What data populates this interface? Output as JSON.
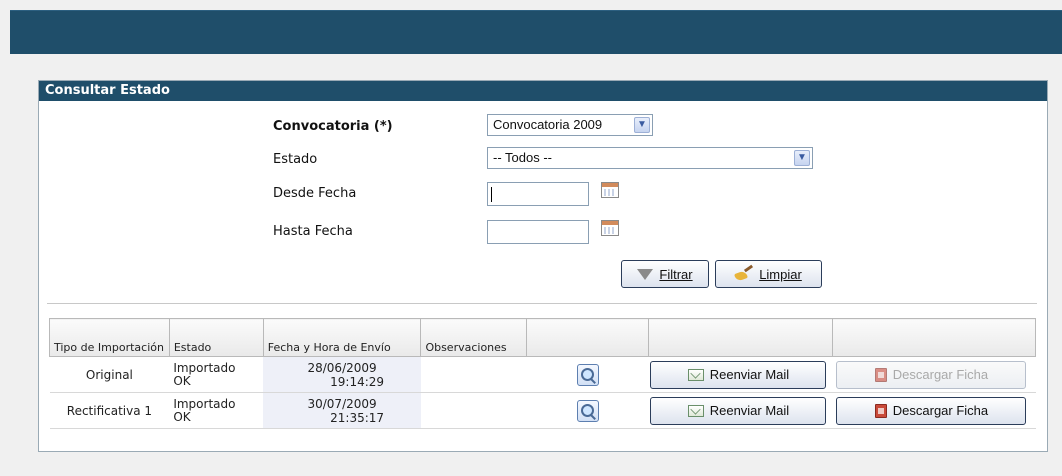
{
  "panel": {
    "title": "Consultar Estado"
  },
  "form": {
    "convocatoria": {
      "label": "Convocatoria (*)",
      "value": "Convocatoria 2009"
    },
    "estado": {
      "label": "Estado",
      "value": "-- Todos --"
    },
    "desde_fecha": {
      "label": "Desde Fecha",
      "value": ""
    },
    "hasta_fecha": {
      "label": "Hasta Fecha",
      "value": ""
    },
    "filtrar_label": "Filtrar",
    "limpiar_label": "Limpiar"
  },
  "grid": {
    "headers": {
      "tipo": "Tipo de Importación",
      "estado": "Estado",
      "fecha": "Fecha y Hora de Envío",
      "observaciones": "Observaciones"
    },
    "reenviar_label": "Reenviar Mail",
    "descargar_label": "Descargar Ficha",
    "rows": [
      {
        "tipo": "Original",
        "estado_l1": "Importado",
        "estado_l2": "OK",
        "fecha": "28/06/2009",
        "hora": "19:14:29",
        "observaciones": "",
        "descargar_enabled": false
      },
      {
        "tipo": "Rectificativa 1",
        "estado_l1": "Importado",
        "estado_l2": "OK",
        "fecha": "30/07/2009",
        "hora": "21:35:17",
        "observaciones": "",
        "descargar_enabled": true
      }
    ]
  },
  "colors": {
    "header_bar": "#1f4e6a",
    "panel_border": "#9aaab5",
    "button_border": "#2b3d5a"
  },
  "icons": [
    "calendar-icon",
    "filter-icon",
    "broom-icon",
    "magnifier-icon",
    "envelope-icon",
    "pdf-icon",
    "chevron-down-icon"
  ]
}
